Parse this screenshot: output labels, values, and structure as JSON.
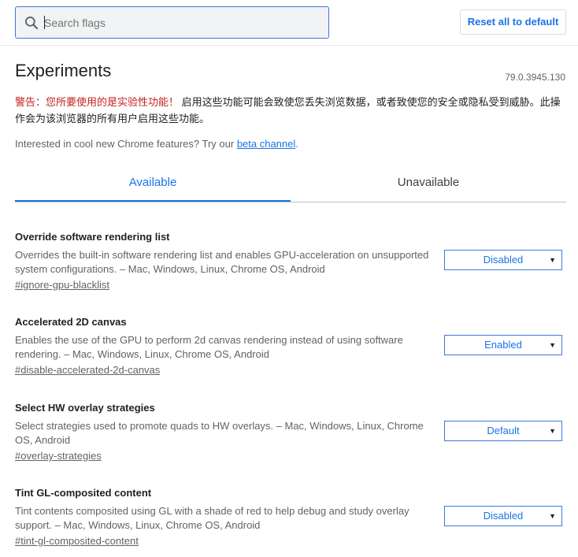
{
  "search": {
    "placeholder": "Search flags"
  },
  "header": {
    "reset_label": "Reset all to default"
  },
  "page": {
    "title": "Experiments",
    "version": "79.0.3945.130",
    "warning_red": "警告：您所要使用的是实验性功能！",
    "warning_text": " 启用这些功能可能会致使您丢失浏览数据，或者致使您的安全或隐私受到威胁。此操作会为该浏览器的所有用户启用这些功能。",
    "interest_text": "Interested in cool new Chrome features? Try our ",
    "interest_link": "beta channel",
    "interest_end": "."
  },
  "tabs": [
    {
      "label": "Available"
    },
    {
      "label": "Unavailable"
    }
  ],
  "experiments": [
    {
      "title": "Override software rendering list",
      "description": "Overrides the built-in software rendering list and enables GPU-acceleration on unsupported system configurations. – Mac, Windows, Linux, Chrome OS, Android",
      "link": "#ignore-gpu-blacklist",
      "value": "Disabled"
    },
    {
      "title": "Accelerated 2D canvas",
      "description": "Enables the use of the GPU to perform 2d canvas rendering instead of using software rendering. – Mac, Windows, Linux, Chrome OS, Android",
      "link": "#disable-accelerated-2d-canvas",
      "value": "Enabled"
    },
    {
      "title": "Select HW overlay strategies",
      "description": "Select strategies used to promote quads to HW overlays. – Mac, Windows, Linux, Chrome OS, Android",
      "link": "#overlay-strategies",
      "value": "Default"
    },
    {
      "title": "Tint GL-composited content",
      "description": "Tint contents composited using GL with a shade of red to help debug and study overlay support. – Mac, Windows, Linux, Chrome OS, Android",
      "link": "#tint-gl-composited-content",
      "value": "Disabled"
    }
  ],
  "colors": {
    "accent": "#1a73e8",
    "warning": "#c5221f"
  },
  "icons": {
    "search": "search-icon",
    "dropdown": "chevron-down-icon"
  }
}
